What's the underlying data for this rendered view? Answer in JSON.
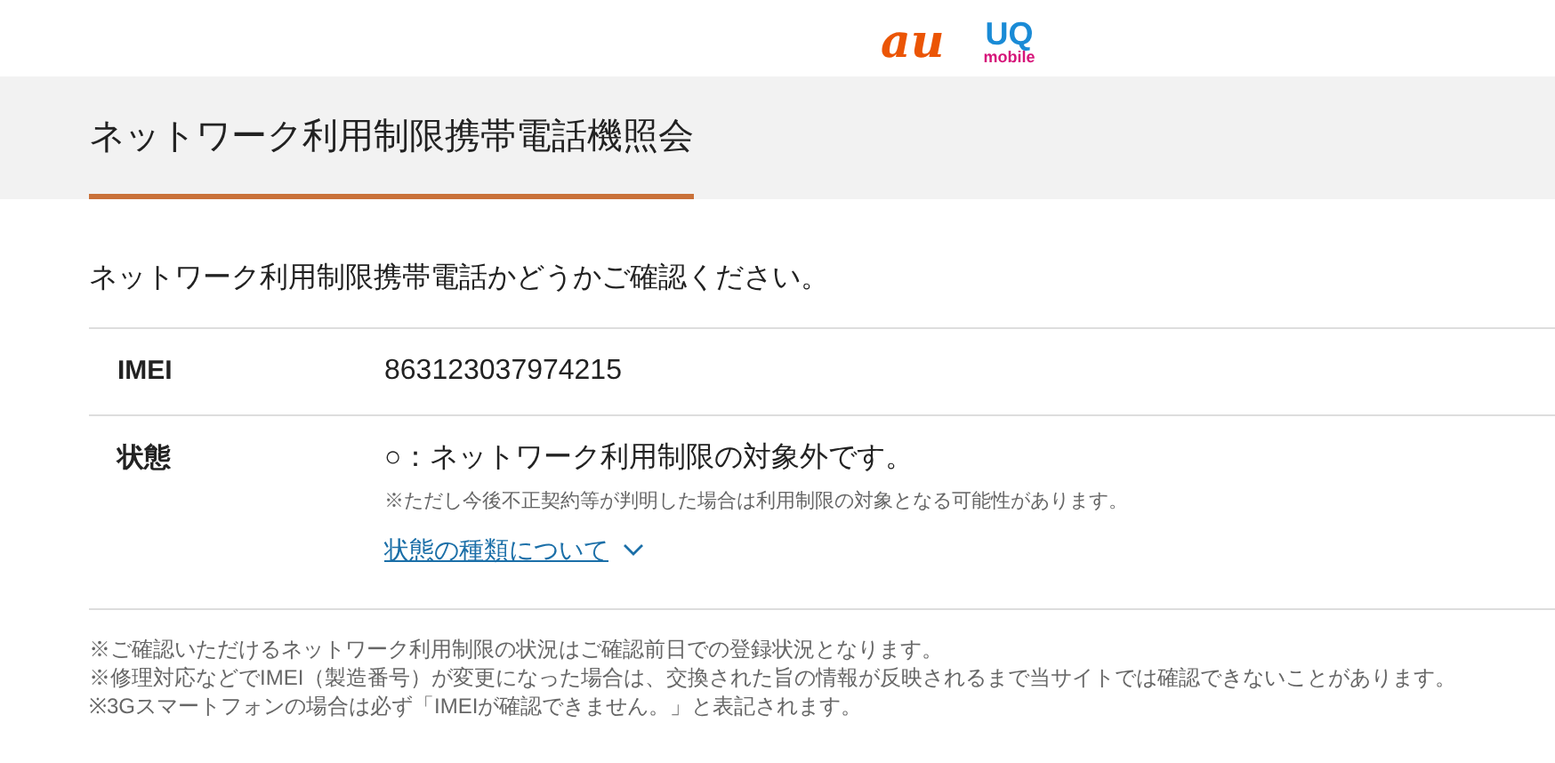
{
  "header": {
    "logos": [
      {
        "kind": "au",
        "text": "au"
      },
      {
        "kind": "uq",
        "text": "UQ",
        "subtext": "mobile"
      }
    ]
  },
  "title": "ネットワーク利用制限携帯電話機照会",
  "intro": "ネットワーク利用制限携帯電話かどうかご確認ください。",
  "table": {
    "rows": [
      {
        "label": "IMEI",
        "value": "863123037974215"
      },
      {
        "label": "状態",
        "value": "○：ネットワーク利用制限の対象外です。",
        "note": "※ただし今後不正契約等が判明した場合は利用制限の対象となる可能性があります。",
        "link": "状態の種類について",
        "expanded": false
      }
    ]
  },
  "notes": [
    "※ご確認いただけるネットワーク利用制限の状況はご確認前日での登録状況となります。",
    "※修理対応などでIMEI（製造番号）が変更になった場合は、交換された旨の情報が反映されるまで当サイトでは確認できないことがあります。",
    "※3Gスマートフォンの場合は必ず「IMEIが確認できません。」と表記されます。"
  ]
}
